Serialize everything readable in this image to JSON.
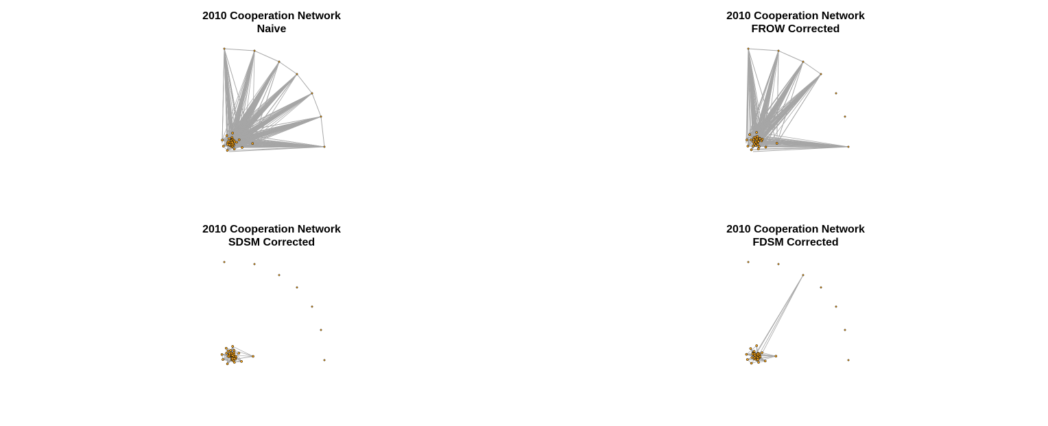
{
  "colors": {
    "edge": "#a6a6a6",
    "node_fill": "#f2a21b",
    "node_stroke": "#000000",
    "background": "#ffffff"
  },
  "panels": [
    {
      "id": "naive",
      "title": "2010 Cooperation Network",
      "subtitle": "Naive",
      "periphery_nodes": 7,
      "fan_edges_to": [
        0,
        1,
        2,
        3,
        4,
        5,
        6
      ],
      "ring_edges": true,
      "cluster_edges": true
    },
    {
      "id": "frow",
      "title": "2010 Cooperation Network",
      "subtitle": "FROW Corrected",
      "periphery_nodes": 7,
      "fan_edges_to": [
        0,
        1,
        2,
        3,
        6
      ],
      "ring_edges": true,
      "cluster_edges": true
    },
    {
      "id": "sdsm",
      "title": "2010 Cooperation Network",
      "subtitle": "SDSM Corrected",
      "periphery_nodes": 7,
      "fan_edges_to": [],
      "ring_edges": false,
      "cluster_edges": true
    },
    {
      "id": "fdsm",
      "title": "2010 Cooperation Network",
      "subtitle": "FDSM Corrected",
      "periphery_nodes": 7,
      "fan_edges_to": [
        2
      ],
      "ring_edges": false,
      "cluster_edges": true
    }
  ]
}
